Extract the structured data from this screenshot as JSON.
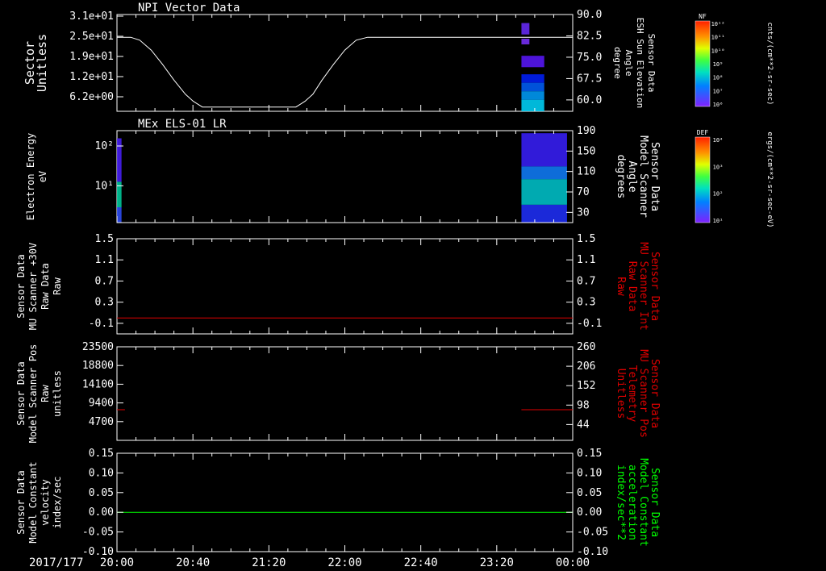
{
  "colors": {
    "background": "#000000",
    "foreground": "#ffffff",
    "red_trace": "#e00000",
    "green_trace": "#00ff00"
  },
  "time_axis": {
    "date_label": "2017/177",
    "ticks": [
      "20:00",
      "20:40",
      "21:20",
      "22:00",
      "22:40",
      "23:20",
      "00:00"
    ],
    "range_hours": [
      20.0,
      24.0
    ]
  },
  "colorbars": [
    {
      "title": "NF",
      "unit_label": "cnts/(cm**2-sr-sec)",
      "tick_labels": [
        "10¹²",
        "10¹¹",
        "10¹⁰",
        "10⁹",
        "10⁸",
        "10⁷",
        "10⁶"
      ]
    },
    {
      "title": "DEF",
      "unit_label": "ergs/(cm**2-sr-sec-eV)",
      "tick_labels": [
        "10⁴",
        "10³",
        "10²",
        "10¹"
      ]
    }
  ],
  "chart_data": [
    {
      "type": "line",
      "panel_title": "NPI Vector Data",
      "ylabel_lines": [
        "Sector",
        "Unitless"
      ],
      "y_tick_labels": [
        "3.1e+01",
        "2.5e+01",
        "1.9e+01",
        "1.2e+01",
        "6.2e+00"
      ],
      "ylim": [
        56.0,
        90.0
      ],
      "y2label_lines": [
        "Sensor Data",
        "ESH Sun Elevation",
        "Angle",
        "degree"
      ],
      "y2_tick_labels": [
        "90.0",
        "82.5",
        "75.0",
        "67.5",
        "60.0"
      ],
      "y2_tick_values": [
        90.0,
        82.5,
        75.0,
        67.5,
        60.0
      ],
      "series": [
        {
          "x": [
            20.0,
            20.12,
            20.2,
            20.3,
            20.4,
            20.5,
            20.6,
            20.67,
            20.75,
            21.0,
            21.3,
            21.57,
            21.65,
            21.72,
            21.8,
            21.9,
            22.0,
            22.1,
            22.2,
            22.3,
            24.0
          ],
          "y": [
            82.0,
            82.0,
            81.0,
            77.5,
            72.5,
            67.0,
            62.0,
            59.5,
            57.5,
            57.5,
            57.5,
            57.5,
            59.5,
            62.0,
            67.0,
            72.5,
            77.5,
            81.0,
            82.0,
            82.0,
            82.0
          ]
        }
      ],
      "spectrogram_blocks": [
        {
          "x": [
            23.55,
            23.62
          ],
          "y": [
            83.0,
            87.0
          ],
          "color": "#6a2cff"
        },
        {
          "x": [
            23.55,
            23.62
          ],
          "y": [
            79.5,
            81.5
          ],
          "color": "#7a30ff"
        },
        {
          "x": [
            23.55,
            23.75
          ],
          "y": [
            71.5,
            75.5
          ],
          "color": "#5a18ff"
        },
        {
          "x": [
            23.55,
            23.75
          ],
          "y": [
            66.0,
            69.0
          ],
          "color": "#0020ff"
        },
        {
          "x": [
            23.55,
            23.75
          ],
          "y": [
            63.0,
            66.0
          ],
          "color": "#0060ff"
        },
        {
          "x": [
            23.55,
            23.75
          ],
          "y": [
            60.0,
            63.0
          ],
          "color": "#00a0ff"
        },
        {
          "x": [
            23.55,
            23.75
          ],
          "y": [
            56.0,
            60.0
          ],
          "color": "#00d8ff"
        }
      ]
    },
    {
      "type": "line",
      "panel_title": "MEx ELS-01 LR",
      "ylabel_lines": [
        "Electron Energy",
        "eV"
      ],
      "y_tick_labels": [
        "10²",
        "10¹"
      ],
      "y_tick_values": [
        160.0,
        82.0
      ],
      "ylim": [
        10.0,
        190.0
      ],
      "y2label_lines": [
        "Sensor Data",
        "Model Scanner",
        "Angle",
        "degrees"
      ],
      "y2_tick_labels": [
        "190",
        "150",
        "110",
        "70",
        "30"
      ],
      "y2_tick_values": [
        190,
        150,
        110,
        70,
        30
      ],
      "series": [
        {
          "x": [
            20.0,
            24.0
          ],
          "y": [
            10.0,
            10.0
          ]
        }
      ],
      "spectrogram_blocks": [
        {
          "x": [
            20.0,
            20.04
          ],
          "y": [
            10.0,
            40.0
          ],
          "color": "#3050ff"
        },
        {
          "x": [
            20.0,
            20.04
          ],
          "y": [
            40.0,
            90.0
          ],
          "color": "#00d0a0"
        },
        {
          "x": [
            20.0,
            20.04
          ],
          "y": [
            90.0,
            175.0
          ],
          "color": "#4a20ff"
        },
        {
          "x": [
            23.55,
            23.95
          ],
          "y": [
            10.0,
            45.0
          ],
          "color": "#2030ff"
        },
        {
          "x": [
            23.55,
            23.95
          ],
          "y": [
            45.0,
            95.0
          ],
          "color": "#00c8d0"
        },
        {
          "x": [
            23.55,
            23.95
          ],
          "y": [
            95.0,
            120.0
          ],
          "color": "#1080ff"
        },
        {
          "x": [
            23.55,
            23.95
          ],
          "y": [
            120.0,
            185.0
          ],
          "color": "#3a20ff"
        }
      ]
    },
    {
      "type": "line",
      "ylabel_lines": [
        "Sensor Data",
        "MU Scanner +30V",
        "Raw Data",
        "Raw"
      ],
      "y_tick_labels": [
        "1.5",
        "1.1",
        "0.7",
        "0.3",
        "-0.1"
      ],
      "y_tick_values": [
        1.5,
        1.1,
        0.7,
        0.3,
        -0.1
      ],
      "ylim": [
        -0.3,
        1.5
      ],
      "y2label_lines": [
        "Sensor Data",
        "MU Scanner Int",
        "Raw Data",
        "Raw"
      ],
      "y2_tick_labels": [
        "1.5",
        "1.1",
        "0.7",
        "0.3",
        "-0.1"
      ],
      "series": [
        {
          "x": [
            20.0,
            24.0
          ],
          "y": [
            0.0,
            0.0
          ],
          "color": "#e00000"
        }
      ]
    },
    {
      "type": "line",
      "ylabel_lines": [
        "Sensor Data",
        "Model Scanner Pos",
        "Raw",
        "unitless"
      ],
      "y_tick_labels": [
        "23500",
        "18800",
        "14100",
        "9400",
        "4700"
      ],
      "y_tick_values": [
        23500,
        18800,
        14100,
        9400,
        4700
      ],
      "ylim": [
        0,
        23500
      ],
      "y2label_lines": [
        "Sensor Data",
        "MU Scanner Pos",
        "Telemetry",
        "Unitless"
      ],
      "y2_tick_labels": [
        "260",
        "206",
        "152",
        "98",
        "44"
      ],
      "y2_tick_values": [
        260,
        206,
        152,
        98,
        44
      ],
      "series": [
        {
          "x": [
            20.0,
            20.07
          ],
          "y": [
            7700,
            7700
          ],
          "color": "#e00000"
        },
        {
          "x": [
            23.55,
            24.0
          ],
          "y": [
            7700,
            7700
          ],
          "color": "#e00000"
        }
      ]
    },
    {
      "type": "line",
      "ylabel_lines": [
        "Sensor Data",
        "Model Constant",
        "velocity",
        "index/sec"
      ],
      "y_tick_labels": [
        "0.15",
        "0.10",
        "0.05",
        "0.00",
        "-0.05",
        "-0.10"
      ],
      "y_tick_values": [
        0.15,
        0.1,
        0.05,
        0.0,
        -0.05,
        -0.1
      ],
      "ylim": [
        -0.1,
        0.15
      ],
      "y2label_lines": [
        "Sensor Data",
        "Model Constant",
        "acceleration",
        "index/sec**2"
      ],
      "y2_tick_labels": [
        "0.15",
        "0.10",
        "0.05",
        "0.00",
        "-0.05",
        "-0.10"
      ],
      "series": [
        {
          "x": [
            20.0,
            24.0
          ],
          "y": [
            0.0,
            0.0
          ],
          "color": "#00ff00"
        }
      ]
    }
  ]
}
